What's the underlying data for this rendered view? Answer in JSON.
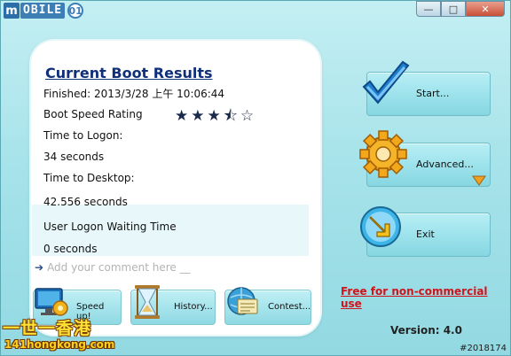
{
  "titlebar": {
    "logo_m": "m",
    "logo_text": "OBILE",
    "logo_circle": "01",
    "minimize": "—",
    "maximize": "□",
    "close": "✕"
  },
  "panel": {
    "title": "Current Boot Results",
    "finished": "Finished: 2013/3/28 上午 10:06:44",
    "boot_speed_label": "Boot Speed Rating",
    "rating_stars": "★★★⯪☆",
    "rating_value": 3.5,
    "rating_max": 5,
    "time_to_logon_label": "Time to Logon:",
    "time_to_logon_value": "34 seconds",
    "time_to_desktop_label": "Time to Desktop:",
    "time_to_desktop_value": "42.556 seconds",
    "user_logon_label": "User Logon Waiting Time",
    "user_logon_value": "0 seconds",
    "comment_placeholder": "Add your comment here __",
    "comment_arrow": "➔"
  },
  "actions": {
    "speed_up": "Speed up!",
    "history": "History...",
    "contest": "Contest..."
  },
  "buttons": {
    "start": "Start...",
    "advanced": "Advanced...",
    "exit": "Exit"
  },
  "footer": {
    "free_link": "Free for non-commercial use",
    "version": "Version: 4.0",
    "image_id": "#2018174"
  },
  "watermark": {
    "line1": "一世一香港",
    "line2": "141hongkong.com"
  },
  "colors": {
    "accent": "#0f2f7a",
    "link_red": "#d0141b",
    "background": "#a9e4ea"
  }
}
